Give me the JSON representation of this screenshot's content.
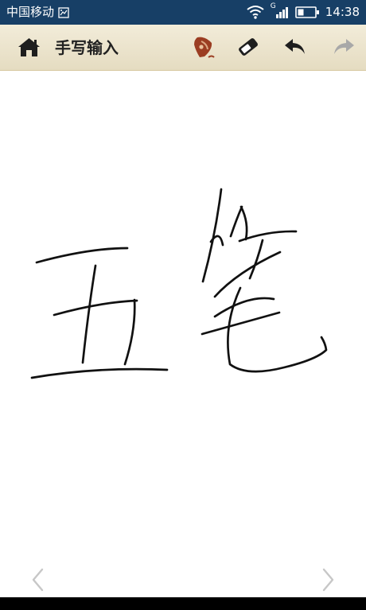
{
  "status_bar": {
    "carrier": "中国移动",
    "network_badge": "G",
    "time": "14:38",
    "icons": [
      "screen-capture-icon",
      "wifi-icon",
      "cellular-signal-icon",
      "battery-icon"
    ]
  },
  "toolbar": {
    "title": "手写输入",
    "home_icon": "home-icon",
    "pen_icon": "pen-nib-icon",
    "eraser_icon": "eraser-icon",
    "undo_icon": "undo-icon",
    "redo_icon": "redo-icon"
  },
  "canvas": {
    "handwriting_characters": "五笔"
  },
  "navigation": {
    "previous_icon": "chevron-left-icon",
    "next_icon": "chevron-right-icon"
  },
  "colors": {
    "status_bar": "#173f66",
    "toolbar_top": "#f2ecd9",
    "toolbar_bottom": "#e5dcc1",
    "ink": "#111111",
    "pen_accent": "#9b3d22",
    "disabled_icon": "#a8a8a8"
  }
}
